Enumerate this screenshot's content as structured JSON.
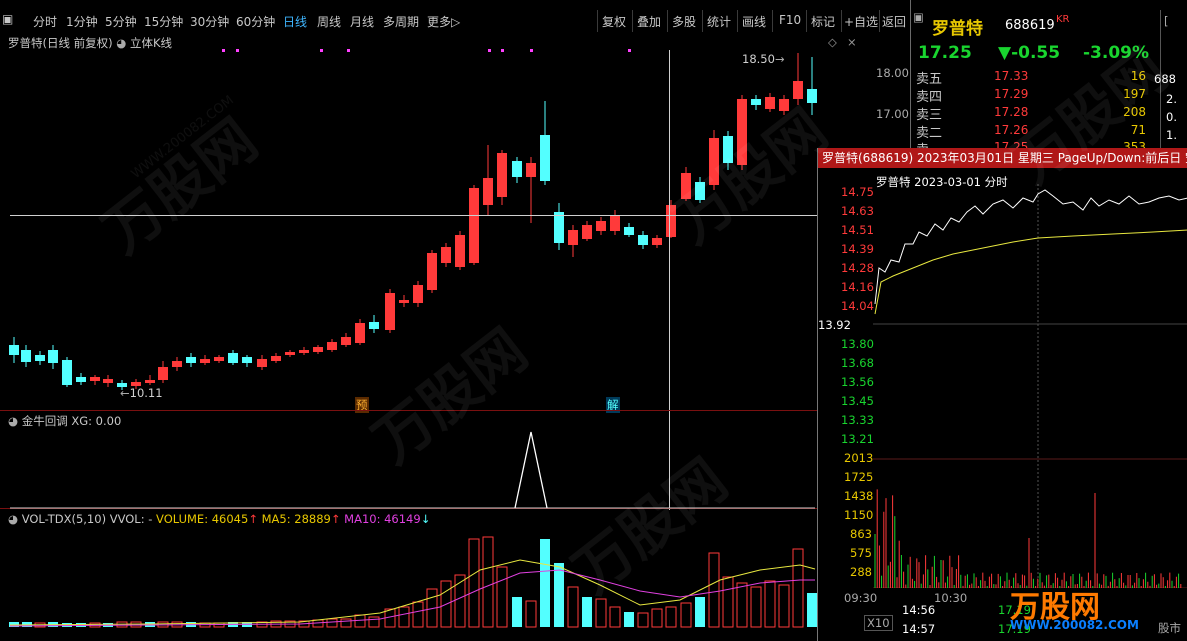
{
  "toolbar": {
    "periods": [
      "分时",
      "1分钟",
      "5分钟",
      "15分钟",
      "30分钟",
      "60分钟",
      "日线",
      "周线",
      "月线",
      "多周期",
      "更多"
    ],
    "active_period": "日线",
    "tools": [
      "复权",
      "叠加",
      "多股",
      "统计",
      "画线",
      "F10",
      "标记",
      "+自选",
      "返回"
    ]
  },
  "main_chart": {
    "title": "罗普特(日线 前复权)",
    "style_label": "立体K线",
    "price_high_label": "18.50",
    "price_low_label": "10.11",
    "axis_labels": [
      "18.00",
      "17.00"
    ],
    "marker_yu": "预",
    "marker_jie": "解"
  },
  "indicator": {
    "label": "金牛回调",
    "xg": "XG: 0.00"
  },
  "volume": {
    "label": "VOL-TDX(5,10)",
    "vvol": "VVOL: -",
    "volume": "VOLUME: 46045",
    "ma5": "MA5: 28889",
    "ma10": "MA10: 46149"
  },
  "quote": {
    "name": "罗普特",
    "code": "688619",
    "tag": "KR",
    "price": "17.25",
    "change": "▼-0.55",
    "change_pct": "-3.09%",
    "right_edge": [
      "688",
      "2.",
      "0.",
      "1.",
      "1."
    ],
    "asks": [
      {
        "label": "卖五",
        "price": "17.33",
        "vol": "16"
      },
      {
        "label": "卖四",
        "price": "17.29",
        "vol": "197"
      },
      {
        "label": "卖三",
        "price": "17.28",
        "vol": "208"
      },
      {
        "label": "卖二",
        "price": "17.26",
        "vol": "71"
      },
      {
        "label": "卖一",
        "price": "17.25",
        "vol": "353"
      }
    ]
  },
  "popup": {
    "title": "罗普特(688619)  2023年03月01日  星期三  PageUp/Down:前后日  空",
    "subtitle": "罗普特   2023-03-01  分时",
    "price_axis": [
      "14.75",
      "14.63",
      "14.51",
      "14.39",
      "14.28",
      "14.16",
      "14.04",
      "13.92",
      "13.80",
      "13.68",
      "13.56",
      "13.45",
      "13.33",
      "13.21"
    ],
    "vol_axis": [
      "2013",
      "1725",
      "1438",
      "1150",
      "863",
      "575",
      "288"
    ],
    "time_labels": [
      "09:30",
      "10:30"
    ],
    "bottom_left": "X10",
    "bottom_times": [
      "14:56",
      "14:57"
    ],
    "bottom_prices": [
      "17.19",
      "17.19"
    ],
    "corner_text": "股市"
  },
  "watermark": {
    "brand": "万股网",
    "url": "WWW.200082.COM"
  },
  "colors": {
    "up": "#ff3a3a",
    "down": "#53ffff",
    "ma5": "#e8e840",
    "ma10": "#e040e0",
    "active": "#3fb6ff",
    "popup_title_bg": "#b01818"
  }
}
